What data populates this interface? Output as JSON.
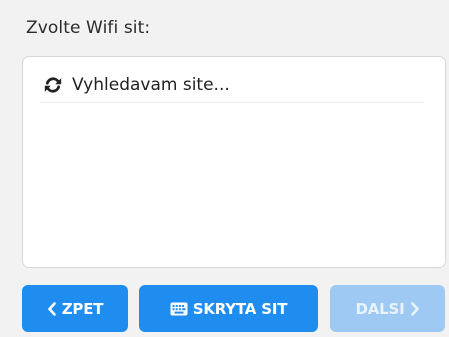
{
  "page": {
    "title": "Zvolte Wifi sit:"
  },
  "network_list": {
    "items": [
      {
        "label": "Vyhledavam site...",
        "icon": "refresh-icon"
      }
    ]
  },
  "buttons": {
    "back": {
      "label": "ZPET",
      "icon": "chevron-left-icon"
    },
    "hidden_network": {
      "label": "SKRYTA SIT",
      "icon": "keyboard-icon"
    },
    "next": {
      "label": "DALSI",
      "icon": "chevron-right-icon",
      "disabled": true
    }
  },
  "colors": {
    "primary": "#1f8df0",
    "disabled": "#9ec9f2",
    "background": "#f2f2f2",
    "panel": "#ffffff"
  }
}
